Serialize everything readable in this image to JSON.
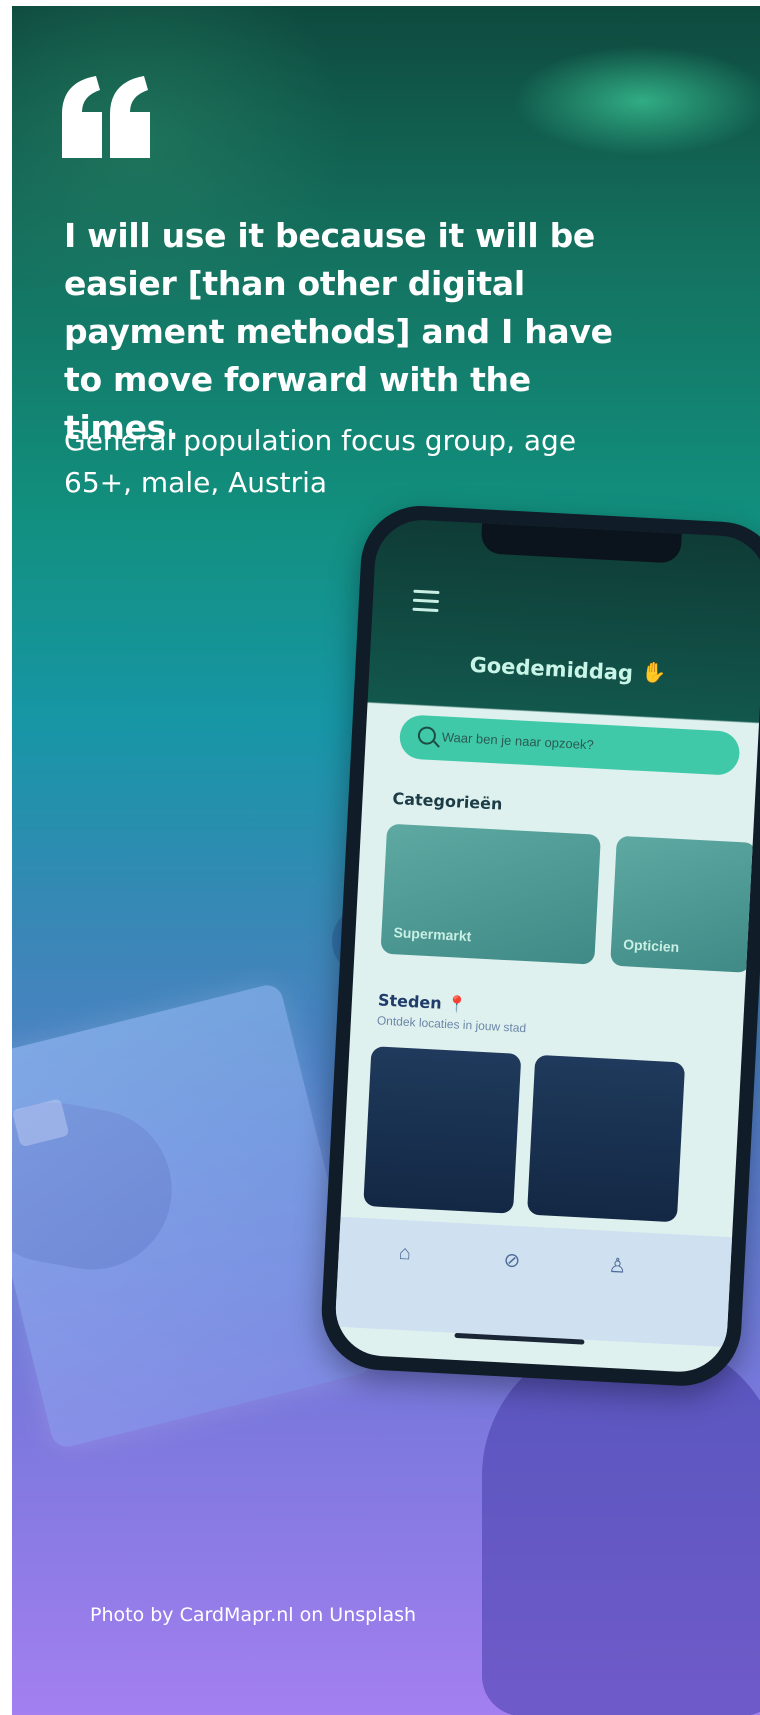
{
  "quote": {
    "text": "I will use it because it will be easier [than other digital payment methods] and I have to move forward with the times.",
    "attribution": "General population focus group, age 65+, male, Austria"
  },
  "photo_credit": "Photo by CardMapr.nl on Unsplash",
  "phone_app": {
    "greeting": "Goedemiddag",
    "search_placeholder": "Waar ben je naar opzoek?",
    "categories_title": "Categorieën",
    "categories": [
      "Supermarkt",
      "Opticien"
    ],
    "cities_title": "Steden",
    "cities_subtitle": "Ontdek locaties in jouw stad"
  },
  "icons": {
    "quote_mark": "open-quote-icon",
    "menu": "menu-icon",
    "wave": "waving-hand-icon",
    "search": "search-icon",
    "pin": "pin-icon",
    "home": "home-icon",
    "explore": "compass-icon",
    "profile": "profile-icon"
  },
  "colors": {
    "gradient_top": "#0e4a3e",
    "gradient_mid": "#1796a6",
    "gradient_bottom": "#a37ff0",
    "text": "#ffffff"
  }
}
